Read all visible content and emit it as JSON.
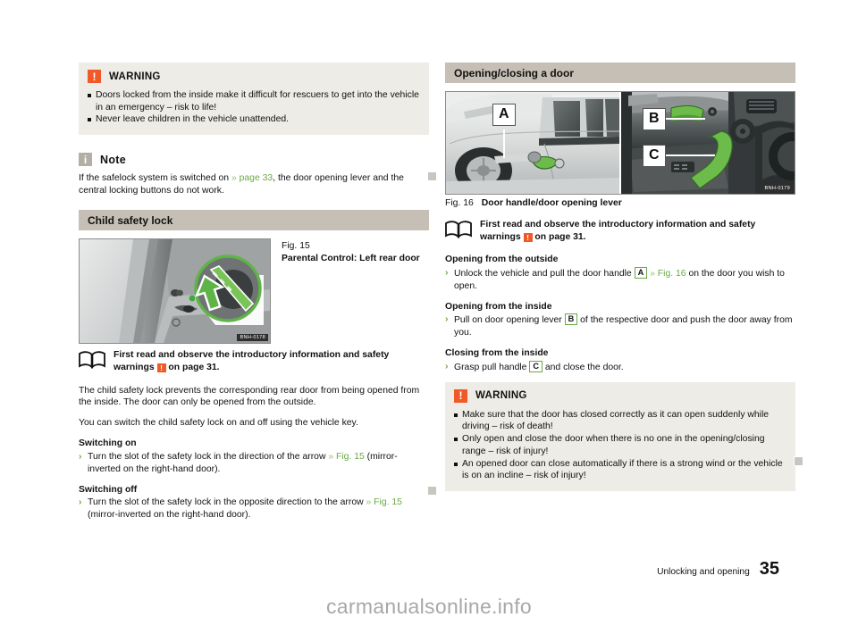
{
  "document": {
    "footer_text": "Unlocking and opening",
    "page_number": "35",
    "watermark": "carmanualsonline.info"
  },
  "left_column": {
    "warning": {
      "icon": "warning-icon",
      "icon_glyph": "!",
      "title": "WARNING",
      "bullets": [
        "Doors locked from the inside make it difficult for rescuers to get into the vehicle in an emergency – risk to life!",
        "Never leave children in the vehicle unattended."
      ]
    },
    "note": {
      "icon": "info-icon",
      "icon_glyph": "i",
      "title": "Note",
      "text_before": "If the safelock system is switched on ",
      "ref_arrow": "»",
      "ref": " page 33",
      "text_after": ", the door opening lever and the central locking buttons do not work."
    },
    "section": {
      "title": "Child safety lock",
      "figure": {
        "label": "Fig. 15",
        "caption": "Parental Control: Left rear door",
        "code": "BNH-0178"
      },
      "read_first": {
        "text_before": "First read and observe the introductory information and safety warnings ",
        "symbol": "!",
        "text_after": " on page 31."
      },
      "paragraphs": [
        "The child safety lock prevents the corresponding rear door from being opened from the inside. The door can only be opened from the outside.",
        "You can switch the child safety lock on and off using the vehicle key."
      ],
      "procedures": [
        {
          "heading": "Switching on",
          "chevron": "›",
          "text_before": "Turn the slot of the safety lock in the direction of the arrow ",
          "ref_arrow": "»",
          "ref": " Fig. 15",
          "text_after": " (mirror-inverted on the right-hand door)."
        },
        {
          "heading": "Switching off",
          "chevron": "›",
          "text_before": "Turn the slot of the safety lock in the opposite direction to the arrow ",
          "ref_arrow": "»",
          "ref": " Fig. 15",
          "text_after": " (mirror-inverted on the right-hand door)."
        }
      ]
    }
  },
  "right_column": {
    "section": {
      "title": "Opening/closing a door",
      "figure": {
        "label": "Fig. 16",
        "caption": "Door handle/door opening lever",
        "code": "BNH-0179",
        "callouts": [
          "A",
          "B",
          "C"
        ]
      },
      "read_first": {
        "text_before": "First read and observe the introductory information and safety warnings ",
        "symbol": "!",
        "text_after": " on page 31."
      },
      "procedures": [
        {
          "heading": "Opening from the outside",
          "chevron": "›",
          "text_before": "Unlock the vehicle and pull the door handle ",
          "key": "A",
          "ref_arrow": "»",
          "ref": " Fig. 16",
          "text_after": " on the door you wish to open."
        },
        {
          "heading": "Opening from the inside",
          "chevron": "›",
          "text_before": "Pull on door opening lever ",
          "key": "B",
          "text_after": " of the respective door and push the door away from you."
        },
        {
          "heading": "Closing from the inside",
          "chevron": "›",
          "text_before": "Grasp pull handle ",
          "key": "C",
          "text_after": " and close the door."
        }
      ]
    },
    "warning": {
      "icon": "warning-icon",
      "icon_glyph": "!",
      "title": "WARNING",
      "bullets": [
        "Make sure that the door has closed correctly as it can open suddenly while driving – risk of death!",
        "Only open and close the door when there is no one in the opening/closing range – risk of injury!",
        "An opened door can close automatically if there is a strong wind or the vehicle is on an incline – risk of injury!"
      ]
    }
  },
  "colors": {
    "accent_green": "#6aa944",
    "warning_orange": "#f05a28",
    "note_grey": "#b3afa7",
    "section_bar": "#c6bfb6",
    "infobox_bg": "#eeece6"
  }
}
